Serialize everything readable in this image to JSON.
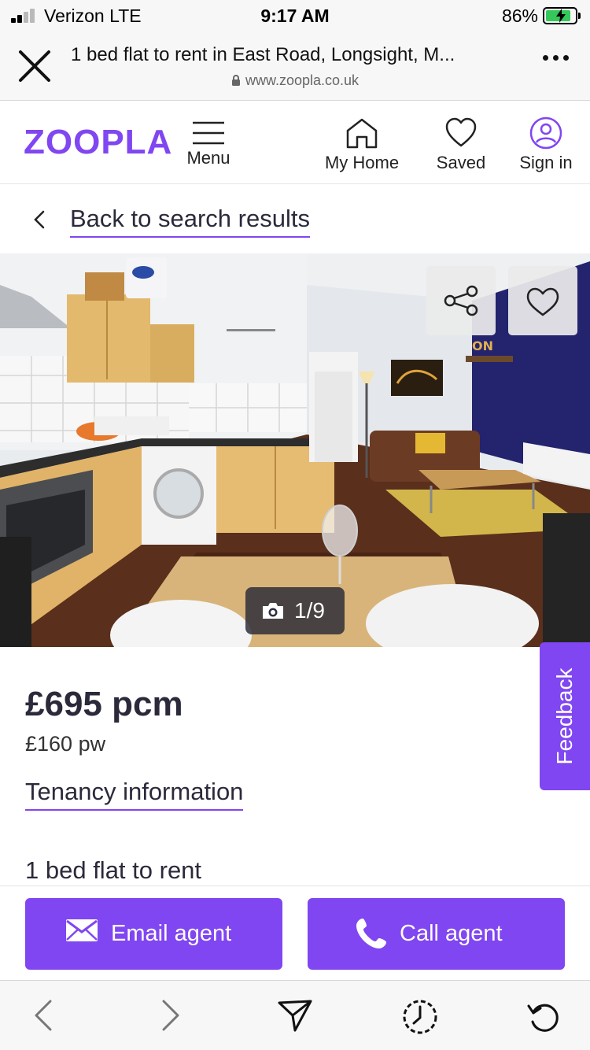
{
  "status_bar": {
    "carrier": "Verizon  LTE",
    "time": "9:17 AM",
    "battery_percent_text": "86%",
    "battery_level": 0.86,
    "signal_bars": 2
  },
  "browser": {
    "page_title": "1 bed flat to rent in East Road, Longsight, M...",
    "url": "www.zoopla.co.uk",
    "close_icon": "close-icon",
    "more_icon": "more-icon"
  },
  "site_header": {
    "logo": "ZOOPLA",
    "menu_label": "Menu",
    "my_home_label": "My Home",
    "saved_label": "Saved",
    "sign_in_label": "Sign in",
    "accent_color": "#8046f1"
  },
  "back_link": "Back to search results",
  "gallery": {
    "counter": "1/9",
    "share_icon": "share-icon",
    "save_icon": "heart-icon"
  },
  "listing": {
    "price_pcm": "£695 pcm",
    "price_pw": "£160 pw",
    "tenancy_link": "Tenancy information",
    "title": "1 bed flat to rent"
  },
  "feedback_label": "Feedback",
  "actions": {
    "email_label": "Email agent",
    "call_label": "Call agent"
  },
  "toolbar": {
    "icons": [
      "back-icon",
      "forward-icon",
      "send-icon",
      "history-icon",
      "reload-icon"
    ]
  }
}
